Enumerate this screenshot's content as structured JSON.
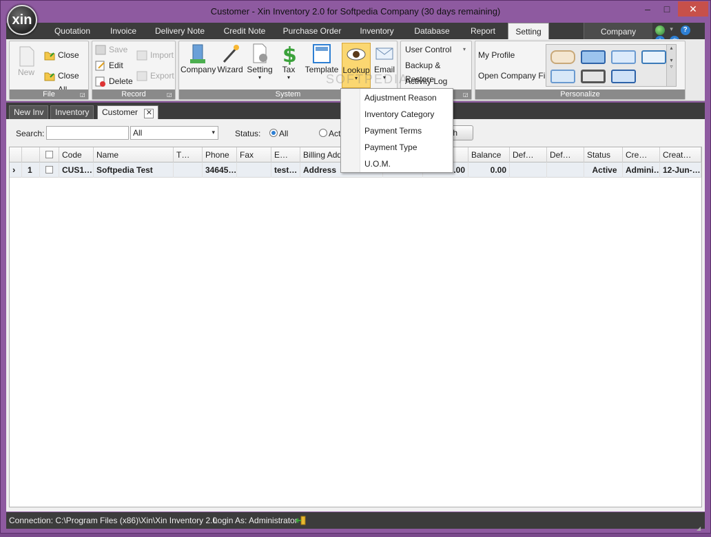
{
  "window": {
    "title": "Customer - Xin Inventory 2.0 for Softpedia Company (30 days remaining)",
    "logo_text": "xin",
    "minimize": "–",
    "maximize": "□",
    "close": "✕"
  },
  "menu": {
    "items": [
      "Quotation",
      "Invoice",
      "Delivery Note",
      "Credit Note",
      "Purchase Order",
      "Inventory",
      "Database",
      "Report",
      "Setting"
    ],
    "active": "Setting",
    "company": "Company"
  },
  "ribbon": {
    "file": {
      "label": "File",
      "new": "New",
      "close": "Close",
      "close_all": "Close All"
    },
    "record": {
      "label": "Record",
      "save": "Save",
      "edit": "Edit",
      "delete": "Delete",
      "import": "Import",
      "export": "Export"
    },
    "system": {
      "label": "System",
      "company": "Company",
      "wizard": "Wizard",
      "setting": "Setting",
      "tax": "Tax",
      "template": "Template",
      "lookup": "Lookup",
      "email": "Email"
    },
    "admin": {
      "user_control": "User Control",
      "backup_restore": "Backup & Restore",
      "activity_log": "Activity Log"
    },
    "personalize": {
      "label": "Personalize",
      "my_profile": "My Profile",
      "open_company_file": "Open Company File"
    }
  },
  "lookup_menu": {
    "items": [
      "Adjustment Reason",
      "Inventory Category",
      "Payment Terms",
      "Payment Type",
      "U.O.M."
    ]
  },
  "doc_tabs": [
    "New Inv",
    "Inventory",
    "Customer"
  ],
  "doc_tab_active": "Customer",
  "search": {
    "label": "Search:",
    "value": "",
    "filter_value": "All",
    "status_label": "Status:",
    "status_all": "All",
    "status_active": "Acti",
    "button_partial": "h"
  },
  "grid": {
    "columns": [
      "",
      "",
      "Code",
      "Name",
      "T…",
      "Phone",
      "Fax",
      "E…",
      "Billing Addre",
      "",
      "…",
      "Balance",
      "Def…",
      "Def…",
      "Status",
      "Cre…",
      "Creat…"
    ],
    "rows": [
      {
        "marker": "›",
        "num": "1",
        "code": "CUS1…",
        "name": "Softpedia Test",
        "t": "",
        "phone": "34645…",
        "fax": "",
        "email": "test…",
        "billing": "Address",
        "c9": "",
        "c10": ".00",
        "balance": "0.00",
        "def1": "",
        "def2": "",
        "status": "Active",
        "created_by": "Admini…",
        "created": "12-Jun-…"
      }
    ]
  },
  "statusbar": {
    "connection": "Connection: C:\\Program Files (x86)\\Xin\\Xin Inventory 2.0",
    "login": "Login As: Administrator"
  },
  "watermark": "SOFTPEDIA",
  "colors": {
    "frame": "#8e5aa0",
    "dark_bar": "#3c3c3c",
    "lookup_highlight": "#fbd771",
    "close_button": "#c7504a"
  }
}
